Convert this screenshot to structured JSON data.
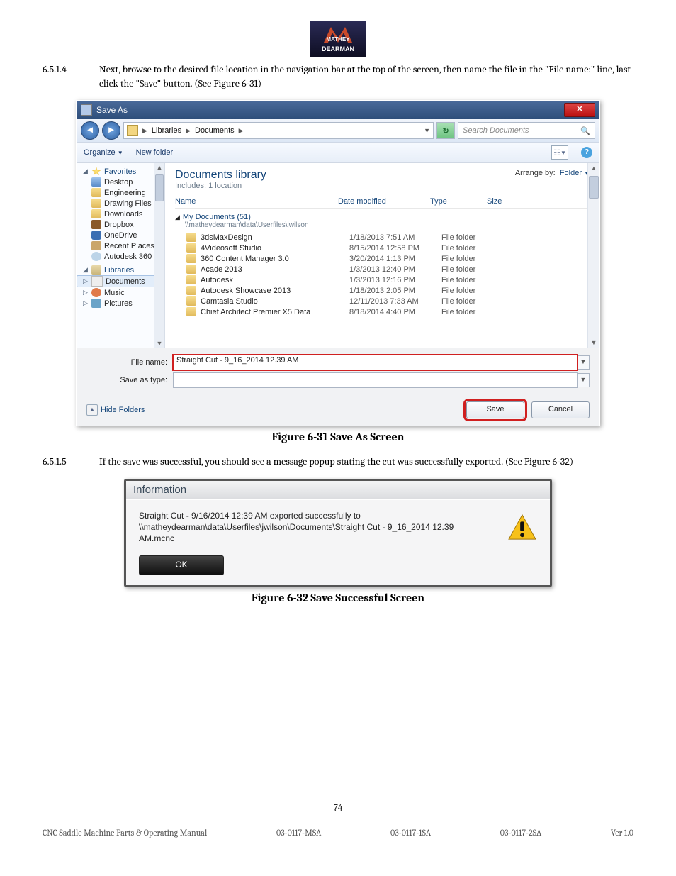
{
  "logo_text_top": "MATHEY",
  "logo_text_bottom": "DEARMAN",
  "para1": {
    "num": "6.5.1.4",
    "text": "Next, browse to the desired file location in the navigation bar at the top of the screen, then name the file in the \"File name:\" line, last click the \"Save\" button. (See Figure 6-31)"
  },
  "para2": {
    "num": "6.5.1.5",
    "text": "If the save was successful, you should see a message popup stating the cut was successfully exported.  (See Figure 6-32)"
  },
  "figcap1": "Figure 6-31 Save As Screen",
  "figcap2": "Figure 6-32 Save Successful Screen",
  "saveas": {
    "title": "Save As",
    "crumbs": [
      "Libraries",
      "Documents"
    ],
    "search_placeholder": "Search Documents",
    "organize": "Organize",
    "newfolder": "New folder",
    "nav_sections": {
      "favorites": "Favorites",
      "libraries": "Libraries"
    },
    "nav_fav": [
      "Desktop",
      "Engineering",
      "Drawing Files",
      "Downloads",
      "Dropbox",
      "OneDrive",
      "Recent Places",
      "Autodesk 360"
    ],
    "nav_lib": [
      "Documents",
      "Music",
      "Pictures"
    ],
    "lib_title": "Documents library",
    "lib_sub": "Includes: 1 location",
    "arrange_label": "Arrange by:",
    "arrange_value": "Folder",
    "columns": {
      "name": "Name",
      "date": "Date modified",
      "type": "Type",
      "size": "Size"
    },
    "group_name": "My Documents (51)",
    "group_path": "\\\\matheydearman\\data\\Userfiles\\jwilson",
    "rows": [
      {
        "name": "3dsMaxDesign",
        "date": "1/18/2013 7:51 AM",
        "type": "File folder"
      },
      {
        "name": "4Videosoft Studio",
        "date": "8/15/2014 12:58 PM",
        "type": "File folder"
      },
      {
        "name": "360 Content Manager 3.0",
        "date": "3/20/2014 1:13 PM",
        "type": "File folder"
      },
      {
        "name": "Acade 2013",
        "date": "1/3/2013 12:40 PM",
        "type": "File folder"
      },
      {
        "name": "Autodesk",
        "date": "1/3/2013 12:16 PM",
        "type": "File folder"
      },
      {
        "name": "Autodesk Showcase 2013",
        "date": "1/18/2013 2:05 PM",
        "type": "File folder"
      },
      {
        "name": "Camtasia Studio",
        "date": "12/11/2013 7:33 AM",
        "type": "File folder"
      },
      {
        "name": "Chief Architect Premier X5 Data",
        "date": "8/18/2014 4:40 PM",
        "type": "File folder"
      }
    ],
    "filename_label": "File name:",
    "filename_value": "Straight Cut - 9_16_2014 12.39 AM",
    "saveas_label": "Save as type:",
    "hide_folders": "Hide Folders",
    "btn_save": "Save",
    "btn_cancel": "Cancel"
  },
  "info": {
    "title": "Information",
    "message": "Straight Cut - 9/16/2014 12:39 AM exported successfully to \\\\matheydearman\\data\\Userfiles\\jwilson\\Documents\\Straight Cut - 9_16_2014 12.39 AM.mcnc",
    "ok": "OK"
  },
  "footer": {
    "page_num": "74",
    "left": "CNC Saddle Machine Parts & Operating Manual",
    "mid1": "03-0117-MSA",
    "mid2": "03-0117-1SA",
    "mid3": "03-0117-2SA",
    "right": "Ver 1.0"
  }
}
